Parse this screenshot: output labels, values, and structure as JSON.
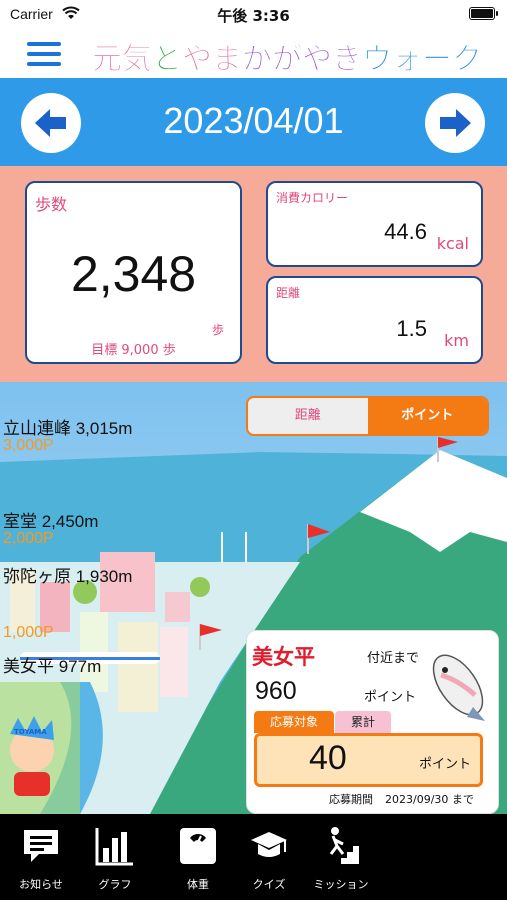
{
  "status_bar": {
    "carrier": "Carrier",
    "time": "午後 3:36"
  },
  "header": {
    "title_parts": [
      "元気",
      "と",
      "やま",
      "かがやき",
      "ウォーク"
    ],
    "title_colors": [
      "#e26aa0",
      "#2ea84a",
      "#e26aa0",
      "#9c59c8",
      "#2b8fe0"
    ]
  },
  "date_nav": {
    "date": "2023/04/01"
  },
  "stats": {
    "steps": {
      "label": "歩数",
      "value": "2,348",
      "unit": "歩",
      "goal": "目標 9,000 歩"
    },
    "calories": {
      "label": "消費カロリー",
      "value": "44.6",
      "unit": "kcal"
    },
    "distance": {
      "label": "距離",
      "value": "1.5",
      "unit": "km"
    }
  },
  "course": {
    "toggle": {
      "distance": "距離",
      "points": "ポイント",
      "selected": "points"
    },
    "checkpoints": [
      {
        "name": "立山連峰 3,015m",
        "points": "3,000P"
      },
      {
        "name": "室堂 2,450m",
        "points": "2,000P"
      },
      {
        "name": "弥陀ヶ原 1,930m",
        "points": ""
      },
      {
        "name": "美女平 977m",
        "points": "1,000P"
      }
    ],
    "mascot_text": "TOYAMA"
  },
  "info_card": {
    "location": "美女平",
    "near_label": "付近まで",
    "remaining": "960",
    "remaining_unit": "ポイント",
    "tab_target": "応募対象",
    "tab_total": "累計",
    "points": "40",
    "points_unit": "ポイント",
    "period_label": "応募期間",
    "period_end": "2023/09/30 まで"
  },
  "tabbar": {
    "items": [
      {
        "label": "お知らせ",
        "icon": "speech-bubble-icon"
      },
      {
        "label": "グラフ",
        "icon": "bar-chart-icon"
      },
      {
        "label": "体重",
        "icon": "scale-icon"
      },
      {
        "label": "クイズ",
        "icon": "graduation-cap-icon"
      },
      {
        "label": "ミッション",
        "icon": "stairs-climber-icon"
      }
    ]
  },
  "colors": {
    "blue": "#2f9be8",
    "salmon": "#f5ab98",
    "orange": "#f47b13",
    "pink": "#e04a7a"
  }
}
